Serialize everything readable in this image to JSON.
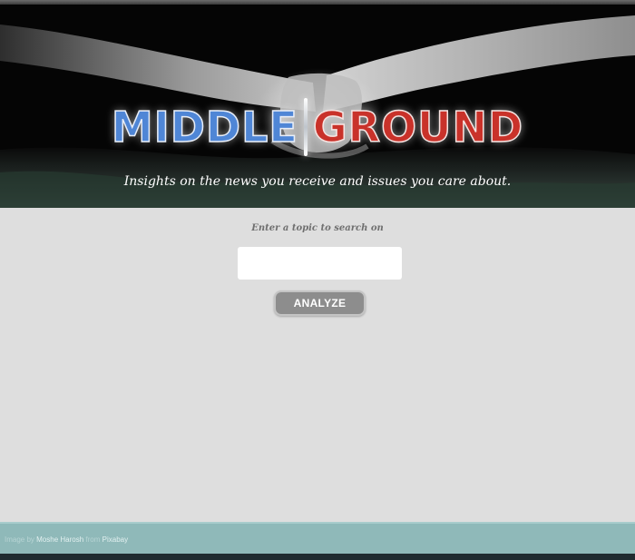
{
  "hero": {
    "logo_left": "MIDDLE",
    "logo_right": "GROUND",
    "tagline": "Insights on the news you receive and issues you care about."
  },
  "search": {
    "prompt": "Enter a topic to search on",
    "value": "",
    "placeholder": "",
    "button_label": "ANALYZE"
  },
  "footer": {
    "credit_prefix": "Image by",
    "credit_author": "Moshe Harosh",
    "credit_middle": "from",
    "credit_source": "Pixabay"
  },
  "colors": {
    "logo_left": "#4f86d6",
    "logo_right": "#c9322a",
    "main_background": "#dedede",
    "footer_background": "#8fb9b9",
    "button_background": "#8d8d8d"
  },
  "icons": {
    "hero_background": "handshake-image"
  }
}
